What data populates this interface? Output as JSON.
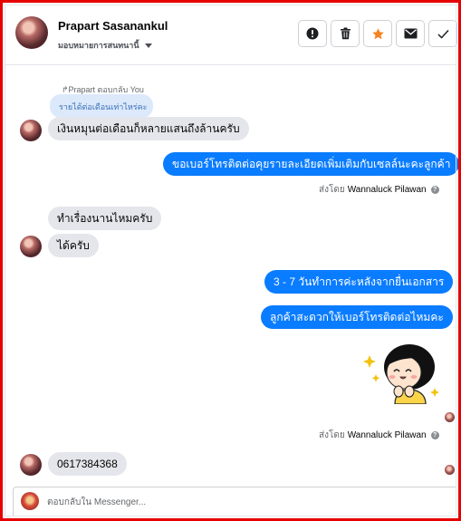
{
  "header": {
    "contact_name": "Prapart Sasanankul",
    "assign_label": "มอบหมายการสนทนานี้",
    "actions": [
      {
        "name": "report",
        "icon": "exclamation-circle-icon"
      },
      {
        "name": "delete",
        "icon": "trash-icon"
      },
      {
        "name": "star",
        "icon": "star-icon",
        "color": "#f5821f"
      },
      {
        "name": "mail",
        "icon": "envelope-icon"
      },
      {
        "name": "done",
        "icon": "checkmark-icon"
      }
    ]
  },
  "conversation": {
    "reply_context": {
      "label": "↱Prapart ตอบกลับ You",
      "quoted_text": "รายได้ต่อเดือนเท่าไหร่คะ"
    },
    "messages": {
      "m1": "เงินหมุนต่อเดือนก็หลายแสนถึงล้านครับ",
      "m2": "ขอเบอร์โทรติดต่อคุยรายละเอียดเพิ่มเติมกับเซลล์นะคะลูกค้า",
      "m3": "ทำเรื่องนานไหมครับ",
      "m4": "ได้ครับ",
      "m5": "3 - 7 วันทำการค่ะหลังจากยื่นเอกสาร",
      "m6": "ลูกค้าสะดวกให้เบอร์โทรติดต่อไหมคะ",
      "m7": "0617384368"
    },
    "sent_by": {
      "prefix": "ส่งโดย",
      "agent": "Wannaluck Pilawan"
    },
    "sticker": "happy-girl-sticker"
  },
  "composer": {
    "placeholder": "ตอบกลับใน Messenger..."
  },
  "colors": {
    "outgoing_bubble": "#0a7cff",
    "incoming_bubble": "#e4e6eb",
    "frame": "#e60000"
  }
}
